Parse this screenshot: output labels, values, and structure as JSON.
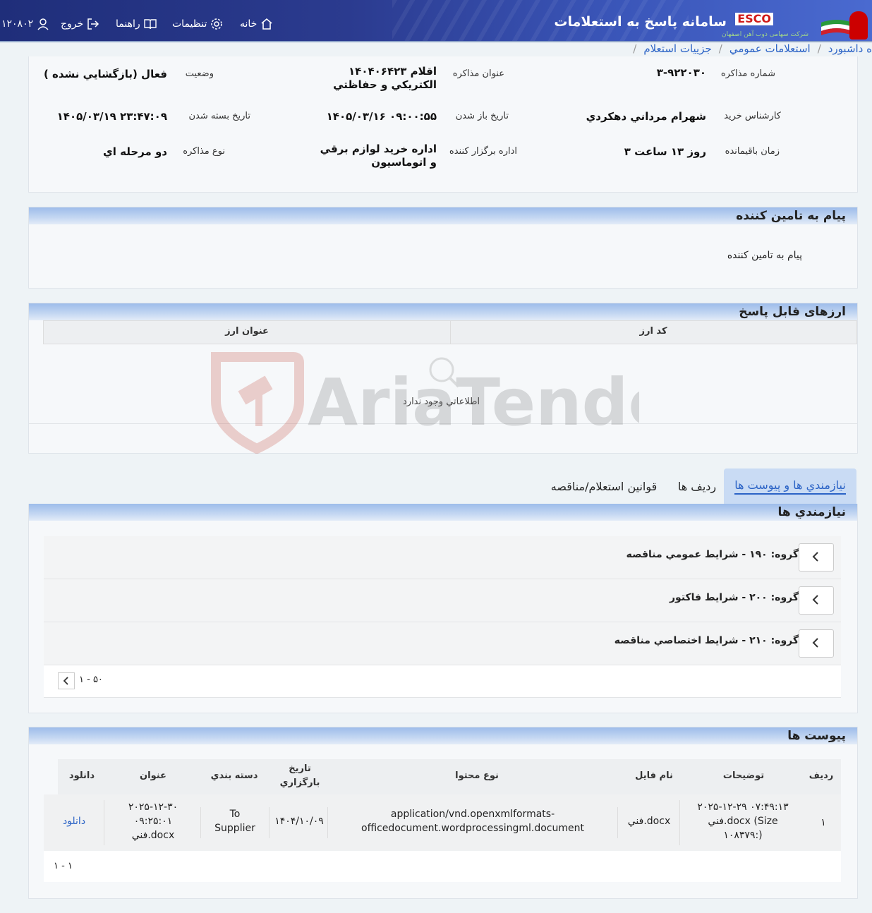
{
  "header": {
    "app_title": "سامانه پاسخ به استعلامات",
    "logo_text": "ESCO",
    "logo_sub": "شرکت سهامی ذوب آهن اصفهان",
    "links": {
      "home": "خانه",
      "settings": "تنظیمات",
      "guide": "راهنما",
      "logout": "خروج",
      "user": "۱۲۰۸۰۲"
    }
  },
  "breadcrumb": {
    "items": [
      "ه داشبورد",
      "استعلامات عمومي",
      "جزييات استعلام"
    ]
  },
  "info": {
    "number_label": "شماره مذاكره",
    "number_value": "۳-۹۲۲۰۳۰",
    "title_label": "عنوان مذاكره",
    "title_value": "۱۴۰۴۰۶۴۲۳ اقلام الكتريكي و حفاظتي",
    "status_label": "وضعيت",
    "status_value": "فعال (بازگشايي نشده )",
    "expert_label": "كارشناس خريد",
    "expert_value": "شهرام مرداني دهكردي",
    "open_label": "تاريخ باز شدن",
    "open_value": "۱۴۰۵/۰۳/۱۶ ۰۹:۰۰:۵۵",
    "close_label": "تاريخ بسته شدن",
    "close_value": "۱۴۰۵/۰۳/۱۹ ۲۳:۴۷:۰۹",
    "remaining_label": "زمان باقيمانده",
    "remaining_value": "۳ روز ۱۳ ساعت",
    "dept_label": "اداره برگزار كننده",
    "dept_value": "اداره خريد لوازم برقي و اتوماسيون",
    "type_label": "نوع مذاكره",
    "type_value": "دو مرحله اي"
  },
  "supplier_msg": {
    "title": "پيام به تامين كننده",
    "body": "پيام به تامين كننده"
  },
  "currencies": {
    "title": "ارزهای قابل پاسخ",
    "columns": [
      "كد ارز",
      "عنوان ارز"
    ],
    "empty": "اطلاعاتي وجود ندارد"
  },
  "watermark": {
    "text": "AriaTender.neT"
  },
  "tabs": [
    "نيازمندي ها و پيوست ها",
    "رديف ها",
    "قوانين استعلام/مناقصه"
  ],
  "requirements": {
    "title": "نيازمندي ها",
    "groups": [
      "گروه: ۱۹۰ - شرايط عمومي مناقصه",
      "گروه: ۲۰۰ - شرايط فاكتور",
      "گروه: ۲۱۰ - شرايط اختصاصي مناقصه"
    ],
    "pager": "۱ - ۵۰"
  },
  "attachments": {
    "title": "پيوست ها",
    "columns": [
      "رديف",
      "توضيحات",
      "نام فايل",
      "نوع محتوا",
      "تاريخ بارگزاري",
      "دسته بندي",
      "عنوان",
      "دانلود"
    ],
    "rows": [
      {
        "idx": "۱",
        "desc_1": "۲۰۲۵-۱۲-۲۹ ۰۷:۴۹:۱۳",
        "desc_2": "فني.docx (Size",
        "desc_3": "۱۰۸۳۷۹:)",
        "file": "فني.docx",
        "mime_1": "application/vnd.openxmlformats-",
        "mime_2": "officedocument.wordprocessingml.document",
        "date": "۱۴۰۴/۱۰/۰۹",
        "cat_1": "To",
        "cat_2": "Supplier",
        "title_1": "۲۰۲۵-۱۲-۳۰",
        "title_2": "۰۹:۲۵:۰۱",
        "title_3": "فني.docx",
        "download": "دانلود"
      }
    ],
    "pager": "۱ - ۱"
  }
}
